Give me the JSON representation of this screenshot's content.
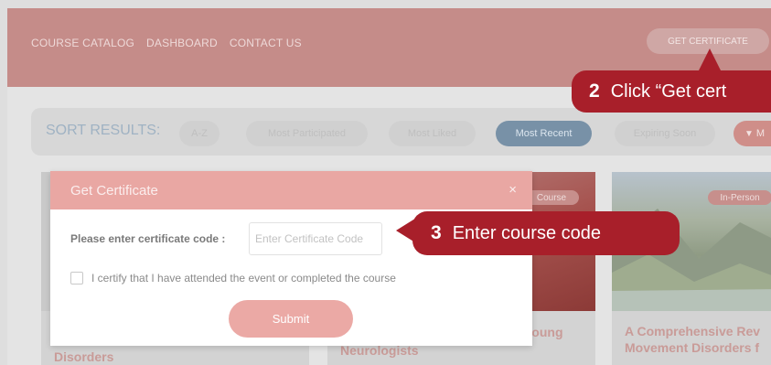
{
  "nav": {
    "links": [
      "COURSE CATALOG",
      "DASHBOARD",
      "CONTACT US"
    ],
    "get_certificate": "GET CERTIFICATE"
  },
  "sort": {
    "label": "SORT RESULTS:",
    "options": [
      "A-Z",
      "Most Participated",
      "Most Liked",
      "Most Recent",
      "Expiring Soon"
    ],
    "active": "Most Recent",
    "filter_label": "M"
  },
  "cards": [
    {
      "title_line1": "Disorders",
      "badge": ""
    },
    {
      "title_line1": "Young",
      "title_line2": "Neurologists",
      "badge": "Course"
    },
    {
      "title_line1": "A Comprehensive Rev",
      "title_line2": "Movement Disorders f",
      "badge": "In-Person"
    }
  ],
  "modal": {
    "title": "Get Certificate",
    "close": "×",
    "code_label": "Please enter certificate code :",
    "code_placeholder": "Enter Certificate Code",
    "code_value": "",
    "certify_text": "I certify that I have attended the event or completed the course",
    "submit": "Submit"
  },
  "callouts": [
    {
      "number": "2",
      "text": "Click “Get cert"
    },
    {
      "number": "3",
      "text": "Enter course code"
    }
  ],
  "colors": {
    "callout": "#a81f2a",
    "modal_header": "#e9a7a3",
    "nav": "#c58c89"
  }
}
